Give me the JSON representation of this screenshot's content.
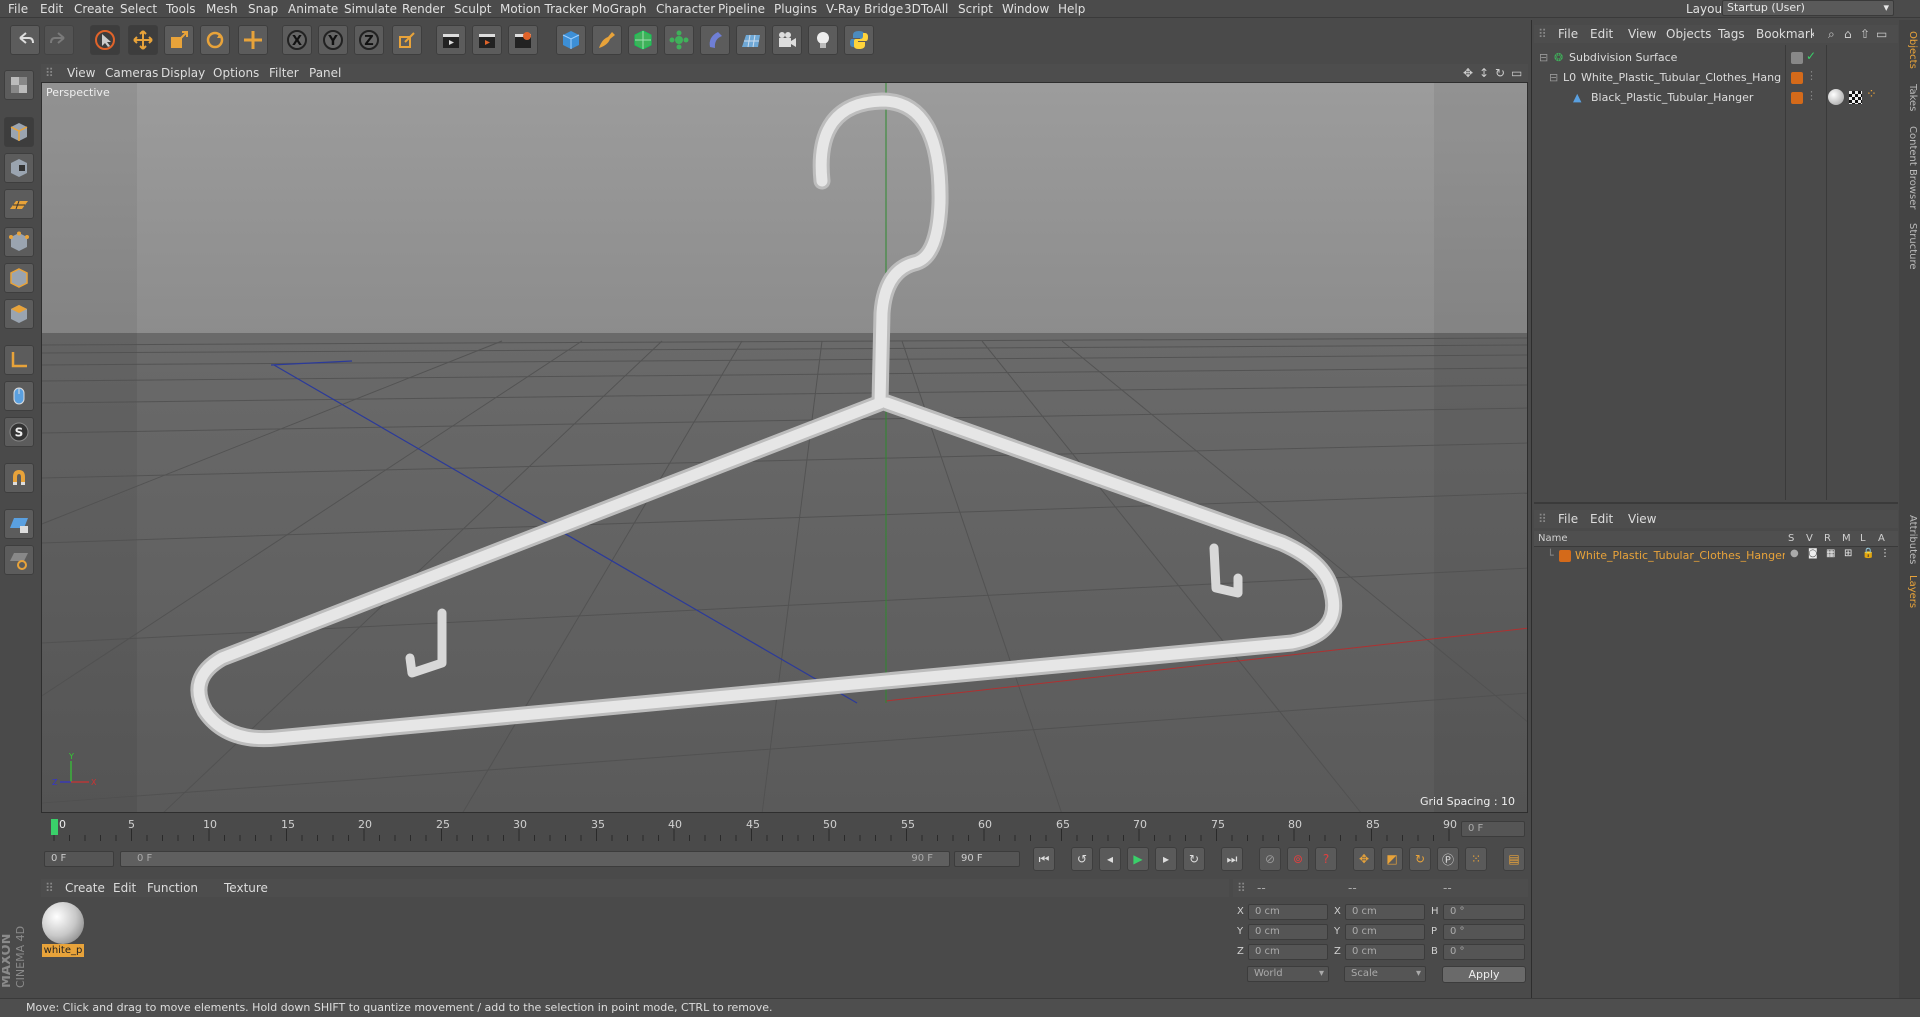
{
  "menu": [
    "File",
    "Edit",
    "Create",
    "Select",
    "Tools",
    "Mesh",
    "Snap",
    "Animate",
    "Simulate",
    "Render",
    "Sculpt",
    "Motion Tracker",
    "MoGraph",
    "Character",
    "Pipeline",
    "Plugins",
    "V-Ray Bridge",
    "3DToAll",
    "Script",
    "Window",
    "Help"
  ],
  "layout": {
    "label": "Layout:",
    "value": "Startup (User)"
  },
  "viewport": {
    "menu": [
      "View",
      "Cameras",
      "Display",
      "Options",
      "Filter",
      "Panel"
    ],
    "name": "Perspective",
    "grid_spacing": "Grid Spacing : 10 cm"
  },
  "objects_panel": {
    "menu": [
      "File",
      "Edit",
      "View",
      "Objects",
      "Tags",
      "Bookmark"
    ],
    "items": [
      {
        "name": "Subdivision Surface"
      },
      {
        "name": "White_Plastic_Tubular_Clothes_Hanger"
      },
      {
        "name": "Black_Plastic_Tubular_Hanger"
      }
    ]
  },
  "layers_panel": {
    "menu": [
      "File",
      "Edit",
      "View"
    ],
    "columns": {
      "name": "Name",
      "s": "S",
      "v": "V",
      "r": "R",
      "m": "M",
      "l": "L",
      "a": "A"
    },
    "items": [
      {
        "name": "White_Plastic_Tubular_Clothes_Hanger"
      }
    ]
  },
  "side_tabs": {
    "top": [
      "Objects",
      "Takes",
      "Content Browser",
      "Structure"
    ],
    "bottom": [
      "Attributes",
      "Layers"
    ]
  },
  "timeline": {
    "ticks": [
      "0",
      "5",
      "10",
      "15",
      "20",
      "25",
      "30",
      "35",
      "40",
      "45",
      "50",
      "55",
      "60",
      "65",
      "70",
      "75",
      "80",
      "85",
      "90"
    ],
    "current_frame": "0 F",
    "start": "0 F",
    "range_start": "0 F",
    "range_end": "90 F",
    "end": "90 F"
  },
  "material_panel": {
    "menu": [
      "Create",
      "Edit",
      "Function",
      "Texture"
    ],
    "material_name": "white_p"
  },
  "coords": {
    "headers": [
      "--",
      "--",
      "--"
    ],
    "rows": [
      {
        "a": "X",
        "av": "0 cm",
        "b": "X",
        "bv": "0 cm",
        "c": "H",
        "cv": "0 °"
      },
      {
        "a": "Y",
        "av": "0 cm",
        "b": "Y",
        "bv": "0 cm",
        "c": "P",
        "cv": "0 °"
      },
      {
        "a": "Z",
        "av": "0 cm",
        "b": "Z",
        "bv": "0 cm",
        "c": "B",
        "cv": "0 °"
      }
    ],
    "mode": "World",
    "scale": "Scale",
    "apply": "Apply"
  },
  "brand": "MAXON CINEMA 4D",
  "status": "Move: Click and drag to move elements. Hold down SHIFT to quantize movement / add to the selection in point mode, CTRL to remove.",
  "colors": {
    "accent": "#e8a33a",
    "tag_orange": "#d46a1a",
    "ui_bg": "#4a4a4a"
  }
}
